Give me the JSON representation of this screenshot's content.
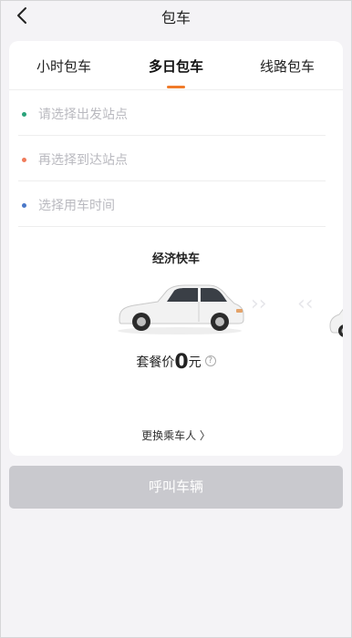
{
  "header": {
    "title": "包车",
    "back_icon": "chevron-left-icon"
  },
  "tabs": [
    {
      "label": "小时包车",
      "active": false
    },
    {
      "label": "多日包车",
      "active": true
    },
    {
      "label": "线路包车",
      "active": false
    }
  ],
  "form": {
    "departure": {
      "placeholder": "请选择出发站点",
      "dot_color": "#2aa37a"
    },
    "arrival": {
      "placeholder": "再选择到达站点",
      "dot_color": "#f07b5a"
    },
    "time": {
      "placeholder": "选择用车时间",
      "dot_color": "#4a78c8"
    }
  },
  "car": {
    "type_label": "经济快车",
    "arrow_right": "››",
    "arrow_left": "‹‹"
  },
  "price": {
    "prefix": "套餐价",
    "value": "0",
    "unit": "元",
    "help_icon": "?"
  },
  "change_passenger": "更换乘车人 〉",
  "call_button": "呼叫车辆",
  "colors": {
    "accent": "#f07b2a",
    "disabled_button": "#c9c9ce",
    "background": "#f4f3f6"
  }
}
